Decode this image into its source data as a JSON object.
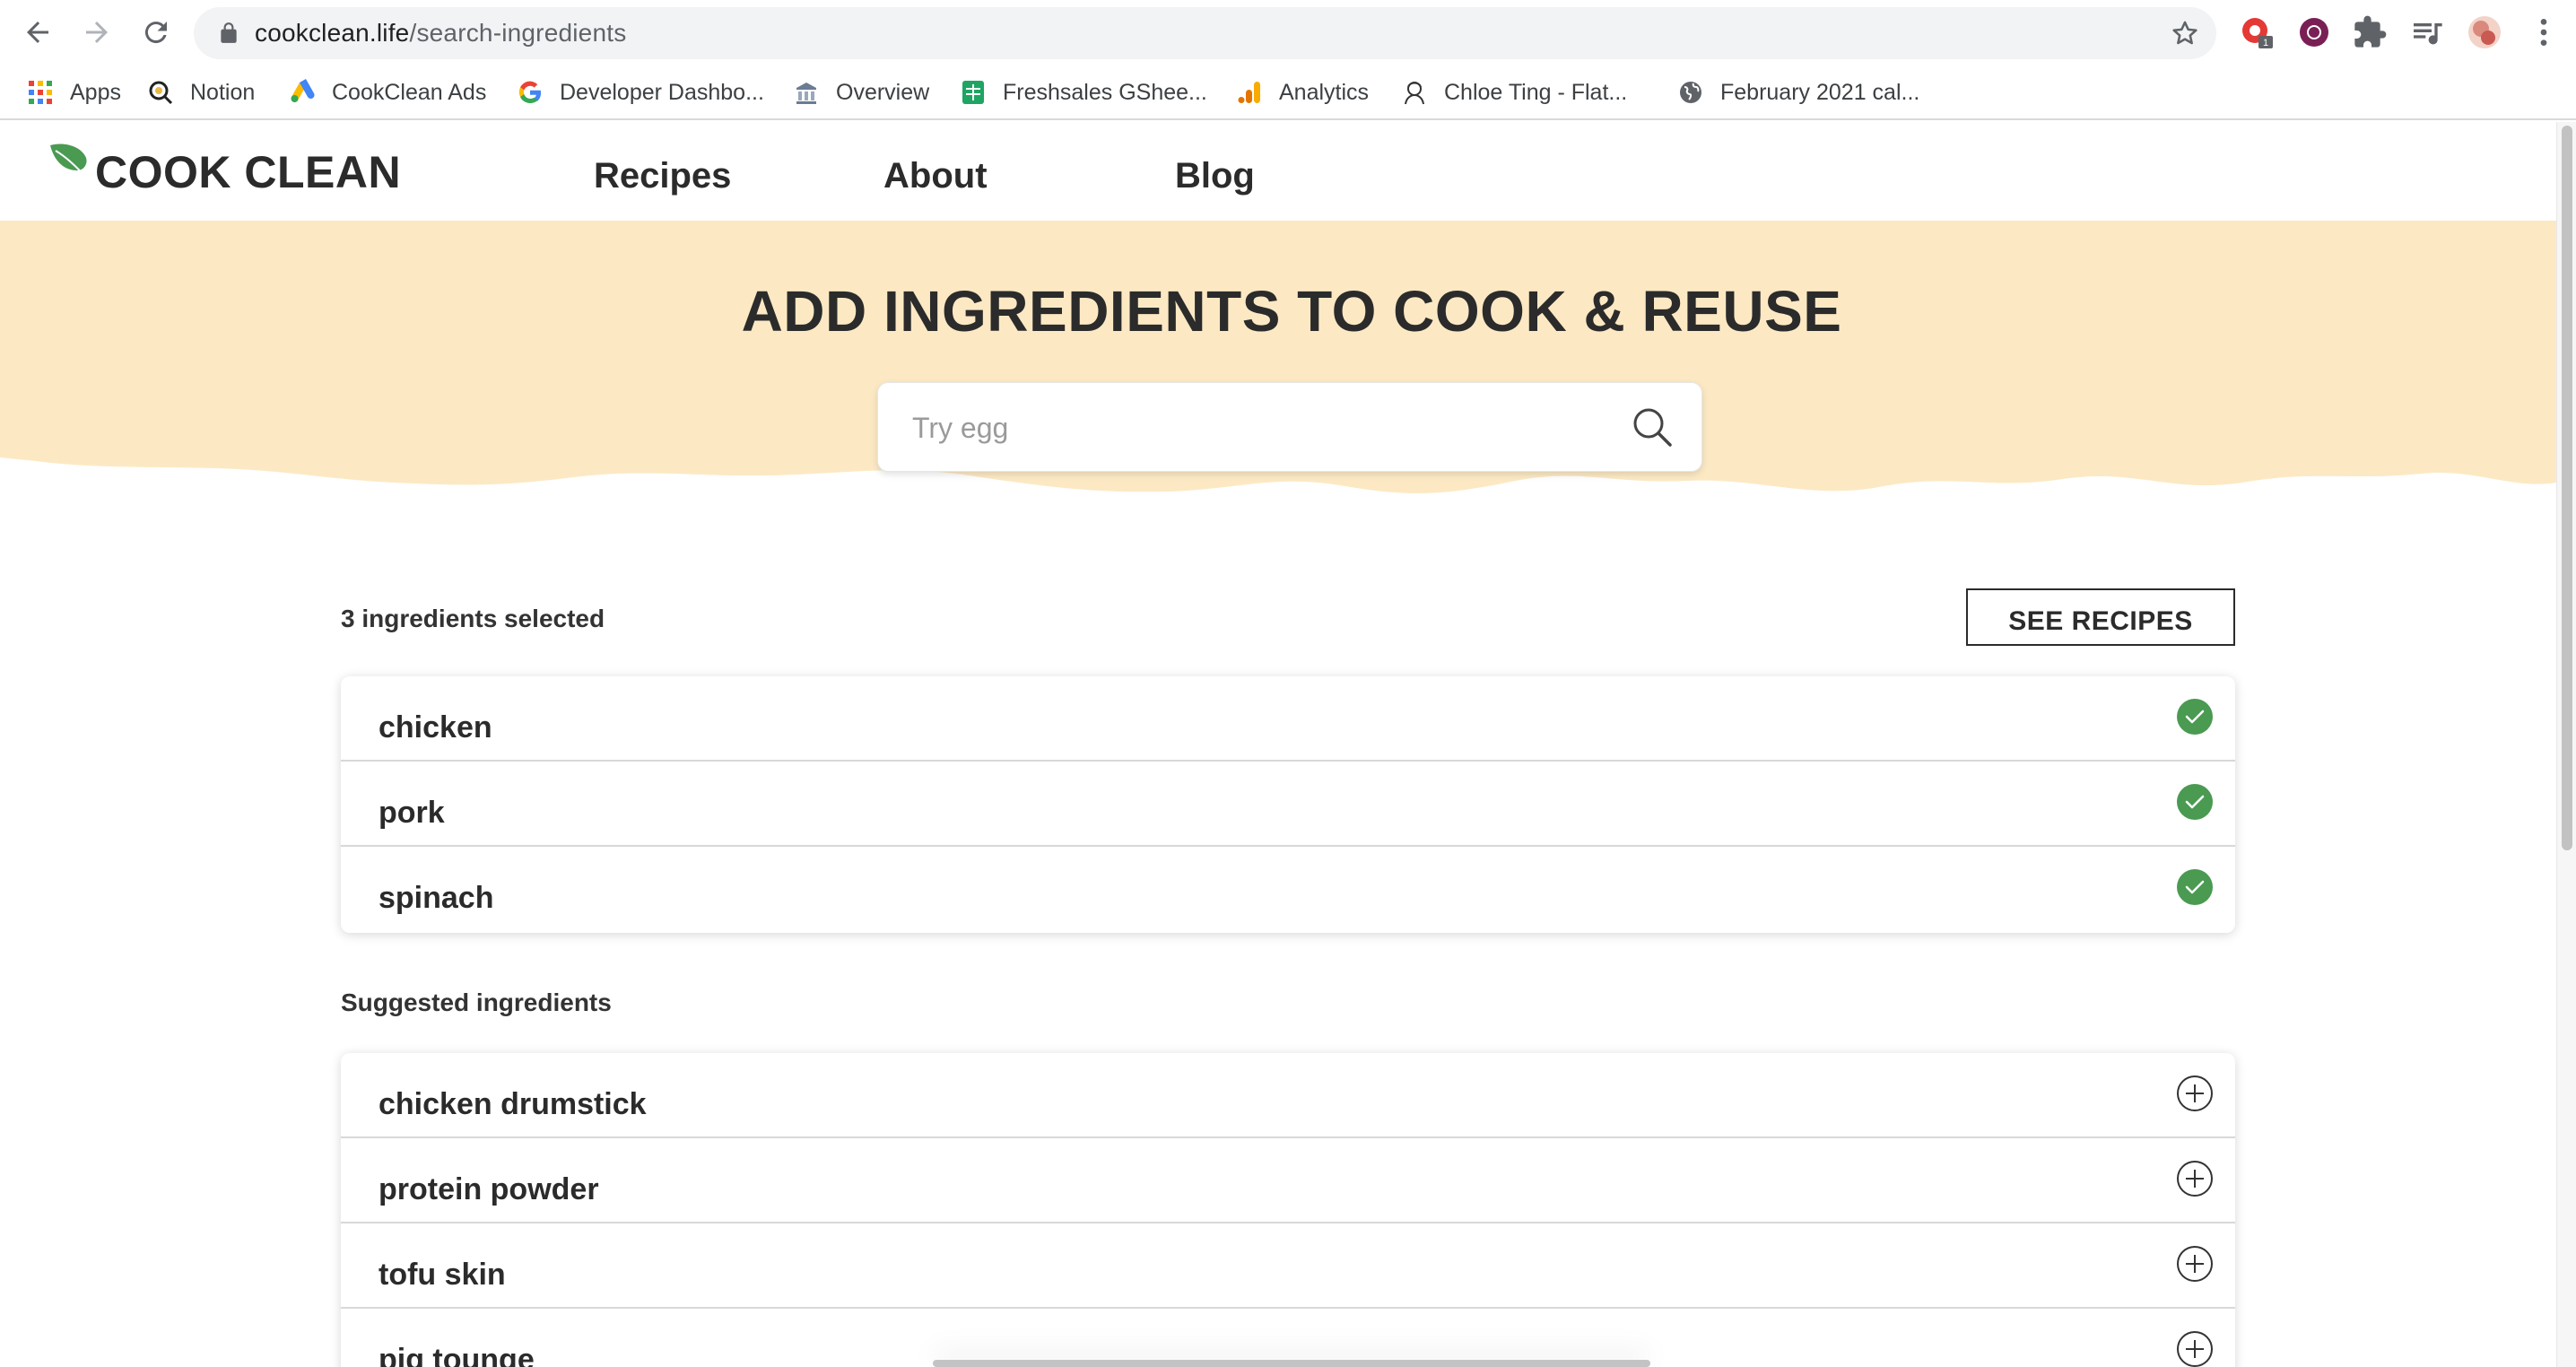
{
  "browser": {
    "url_host": "cookclean.life",
    "url_path": "/search-ingredients",
    "extension_badge": "1",
    "bookmarks": [
      {
        "label": "Apps",
        "icon": "apps-grid-icon"
      },
      {
        "label": "Notion",
        "icon": "notion-icon"
      },
      {
        "label": "CookClean Ads",
        "icon": "google-ads-icon"
      },
      {
        "label": "Developer Dashbo...",
        "icon": "google-icon"
      },
      {
        "label": "Overview",
        "icon": "overview-icon"
      },
      {
        "label": "Freshsales GShee...",
        "icon": "google-sheets-icon"
      },
      {
        "label": "Analytics",
        "icon": "analytics-icon"
      },
      {
        "label": "Chloe Ting - Flat...",
        "icon": "chloe-ting-icon"
      },
      {
        "label": "February 2021 cal...",
        "icon": "globe-icon"
      }
    ]
  },
  "site": {
    "logo_text": "COOK CLEAN",
    "nav": [
      "Recipes",
      "About",
      "Blog"
    ],
    "hero_title": "ADD INGREDIENTS TO COOK & REUSE",
    "search_placeholder": "Try egg",
    "selected_label": "3 ingredients selected",
    "see_recipes_label": "SEE RECIPES",
    "selected_ingredients": [
      "chicken",
      "pork",
      "spinach"
    ],
    "suggested_label": "Suggested ingredients",
    "suggested_ingredients": [
      "chicken drumstick",
      "protein powder",
      "tofu skin",
      "pig tounge"
    ],
    "colors": {
      "hero_bg": "#fce9c4",
      "check_green": "#4a9a52",
      "logo_leaf": "#4a9a52",
      "text_dark": "#2b2b2b"
    }
  }
}
